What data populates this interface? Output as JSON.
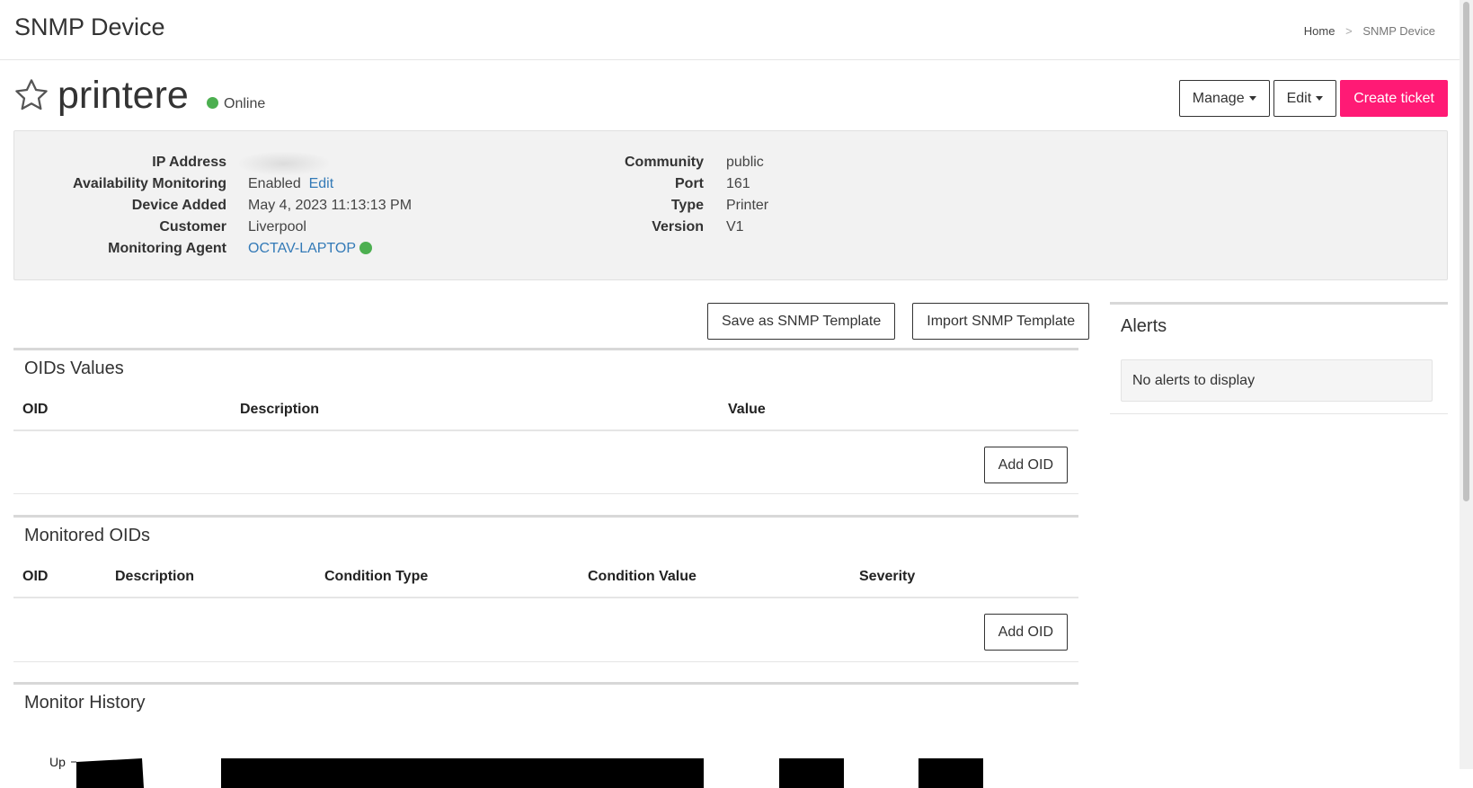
{
  "header": {
    "title": "SNMP Device",
    "breadcrumb": {
      "home": "Home",
      "separator": ">",
      "current": "SNMP Device"
    }
  },
  "device": {
    "name": "printere",
    "status": "Online",
    "status_color": "#4caf50",
    "favorite_icon": "star-outline-icon"
  },
  "actions": {
    "manage": "Manage",
    "edit": "Edit",
    "create_ticket": "Create ticket",
    "create_ticket_color": "#ff1a75"
  },
  "info": {
    "left": {
      "ip_address_label": "IP Address",
      "availability_label": "Availability Monitoring",
      "availability_value": "Enabled",
      "availability_edit": "Edit",
      "device_added_label": "Device Added",
      "device_added_value": "May 4, 2023 11:13:13 PM",
      "customer_label": "Customer",
      "customer_value": "Liverpool",
      "agent_label": "Monitoring Agent",
      "agent_value": "OCTAV-LAPTOP"
    },
    "right": {
      "community_label": "Community",
      "community_value": "public",
      "port_label": "Port",
      "port_value": "161",
      "type_label": "Type",
      "type_value": "Printer",
      "version_label": "Version",
      "version_value": "V1"
    }
  },
  "templates": {
    "save": "Save as SNMP Template",
    "import": "Import SNMP Template"
  },
  "oids_values": {
    "title": "OIDs Values",
    "columns": [
      "OID",
      "Description",
      "Value"
    ],
    "add_button": "Add OID"
  },
  "monitored_oids": {
    "title": "Monitored OIDs",
    "columns": [
      "OID",
      "Description",
      "Condition Type",
      "Condition Value",
      "Severity"
    ],
    "add_button": "Add OID"
  },
  "monitor_history": {
    "title": "Monitor History",
    "y_label": "Up"
  },
  "alerts": {
    "title": "Alerts",
    "empty_message": "No alerts to display"
  }
}
